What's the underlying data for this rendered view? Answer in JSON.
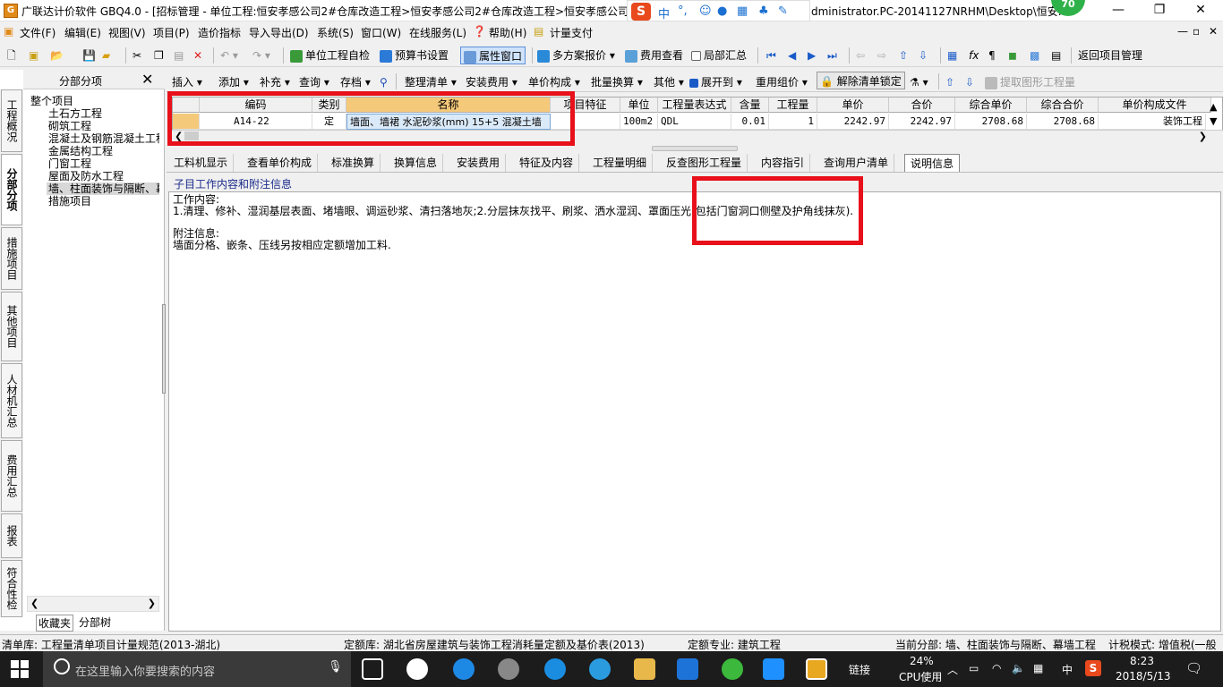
{
  "window": {
    "title": "广联达计价软件 GBQ4.0 - [招标管理 - 单位工程:恒安孝感公司2#仓库改造工程>恒安孝感公司2#仓库改造工程>恒安孝感公司2#",
    "path_fragment": "dministrator.PC-20141127NRHM\\Desktop\\恒安...",
    "badge": "70",
    "ime_label": "中"
  },
  "menu": {
    "items": [
      "文件(F)",
      "编辑(E)",
      "视图(V)",
      "项目(P)",
      "造价指标",
      "导入导出(D)",
      "系统(S)",
      "窗口(W)",
      "在线服务(L)",
      "帮助(H)",
      "计量支付"
    ]
  },
  "toolbar1": {
    "unit_check": "单位工程自检",
    "budget_settings": "预算书设置",
    "property_window": "属性窗口",
    "multi_quote": "多方案报价",
    "fee_view": "费用查看",
    "partial_summary": "局部汇总",
    "return_project": "返回项目管理"
  },
  "left_panel": {
    "header": "分部分项",
    "vertical_tabs": [
      "工程概况",
      "分部分项",
      "措施项目",
      "其他项目",
      "人材机汇总",
      "费用汇总",
      "报表",
      "符合性检查"
    ],
    "tree": [
      "整个项目",
      "土石方工程",
      "砌筑工程",
      "混凝土及钢筋混凝土工程",
      "金属结构工程",
      "门窗工程",
      "屋面及防水工程",
      "墙、柱面装饰与隔断、幕墙工程",
      "措施项目"
    ],
    "bottom_tabs": [
      "收藏夹",
      "分部树"
    ]
  },
  "toolbar2": {
    "items": [
      "插入",
      "添加",
      "补充",
      "查询",
      "存档",
      "整理清单",
      "安装费用",
      "单价构成",
      "批量换算",
      "其他",
      "展开到",
      "重用组价",
      "解除清单锁定",
      "提取图形工程量"
    ]
  },
  "grid": {
    "headers": [
      "编码",
      "类别",
      "名称",
      "项目特征",
      "单位",
      "工程量表达式",
      "含量",
      "工程量",
      "单价",
      "合价",
      "综合单价",
      "综合合价",
      "单价构成文件"
    ],
    "row": [
      "A14-22",
      "定",
      "墙面、墙裙 水泥砂浆(mm) 15+5 混凝土墙",
      "",
      "100m2",
      "QDL",
      "0.01",
      "1",
      "2242.97",
      "2242.97",
      "2708.68",
      "2708.68",
      "装饰工程"
    ]
  },
  "bottom_tabs": {
    "items": [
      "工料机显示",
      "查看单价构成",
      "标准换算",
      "换算信息",
      "安装费用",
      "特征及内容",
      "工程量明细",
      "反查图形工程量",
      "内容指引",
      "查询用户清单",
      "说明信息"
    ],
    "active": "说明信息"
  },
  "content": {
    "section_title": "子目工作内容和附注信息",
    "work_label": "工作内容:",
    "work_text": "1.清理、修补、湿润基层表面、堵墙眼、调运砂浆、清扫落地灰;2.分层抹灰找平、刷浆、洒水湿润、罩面压光(包括门窗洞口侧壁及护角线抹灰).",
    "note_label": "附注信息:",
    "note_text": "墙面分格、嵌条、压线另按相应定额增加工料."
  },
  "status": {
    "bill_lib": "清单库:  工程量清单项目计量规范(2013-湖北)",
    "quota_lib": "定额库:  湖北省房屋建筑与装饰工程消耗量定额及基价表(2013)",
    "quota_major": "定额专业:  建筑工程",
    "current_section": "当前分部:  墙、柱面装饰与隔断、幕墙工程",
    "tax_mode": "计税模式:  增值税(一般"
  },
  "taskbar": {
    "search_placeholder": "在这里输入你要搜索的内容",
    "link": "链接",
    "cpu_percent": "24%",
    "cpu_label": "CPU使用",
    "ime": "中",
    "time": "8:23",
    "date": "2018/5/13"
  },
  "colors": {
    "highlight_red": "#e8101a",
    "selected_header": "#f5c97a"
  }
}
